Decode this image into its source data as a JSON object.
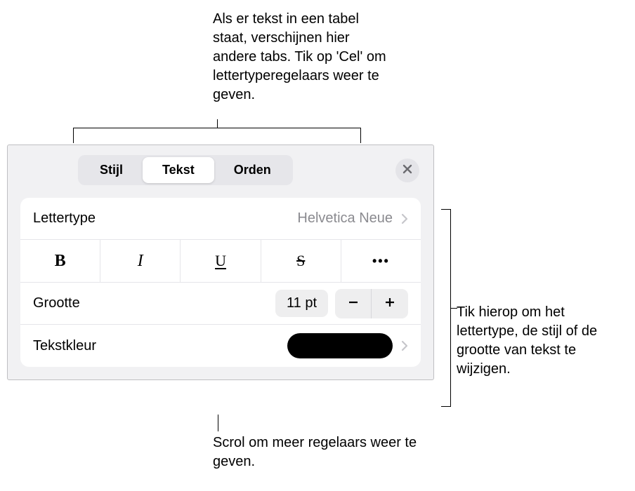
{
  "annotations": {
    "top": "Als er tekst in een tabel staat, verschijnen hier andere tabs. Tik op 'Cel' om lettertyperegelaars weer te geven.",
    "right": "Tik hierop om het lettertype, de stijl of de grootte van tekst te wijzigen.",
    "bottom": "Scrol om meer regelaars weer te geven."
  },
  "tabs": {
    "style": "Stijl",
    "text": "Tekst",
    "arrange": "Orden",
    "active": "text"
  },
  "font": {
    "label": "Lettertype",
    "value": "Helvetica Neue"
  },
  "textStyles": {
    "bold": "B",
    "italic": "I",
    "underline": "U",
    "strike": "S",
    "more": "•••"
  },
  "size": {
    "label": "Grootte",
    "value": "11 pt"
  },
  "textColor": {
    "label": "Tekstkleur",
    "value": "#000000"
  }
}
